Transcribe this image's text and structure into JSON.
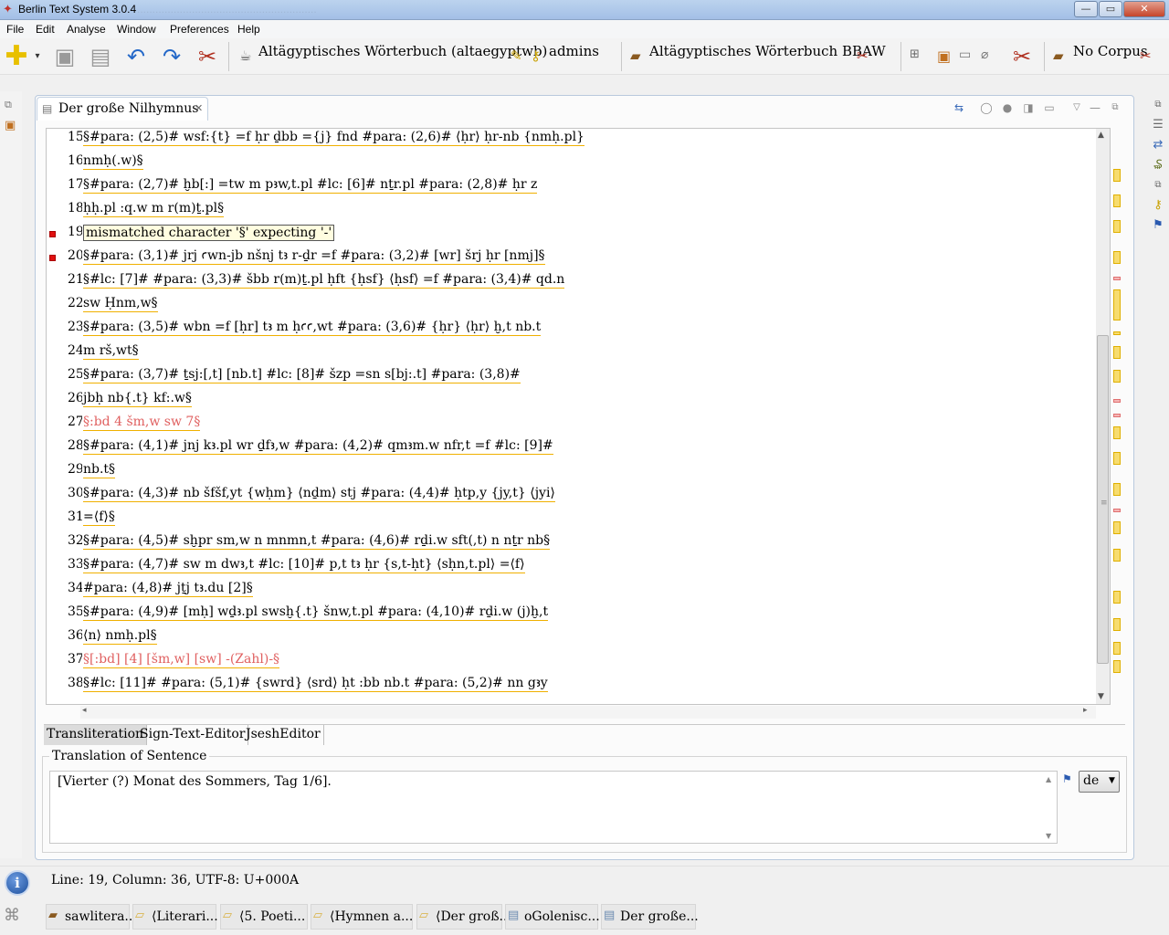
{
  "window": {
    "title": "Berlin Text System 3.0.4",
    "ghost_path": "...........................................................",
    "min": "—",
    "max": "▭",
    "close": "✕"
  },
  "menu": [
    "File",
    "Edit",
    "Analyse",
    "Window",
    "Preferences",
    "Help"
  ],
  "toolbar": {
    "dictionary_label": "Altägyptisches Wörterbuch (altaegyptwb)",
    "user_label": "admins",
    "project_label": "Altägyptisches Wörterbuch BBAW",
    "corpus_label": "No Corpus"
  },
  "editor": {
    "tab_title": "Der große Nilhymnus",
    "tooltip": "mismatched character '§' expecting '-'",
    "lines": [
      {
        "n": "15",
        "text": "§#para: (2,5)# wsf:{t} =f ḥr ḏbb ={j} fnd #para: (2,6)# ⟨ḥr⟩ ḥr-nb {nmḥ.pl}"
      },
      {
        "n": "16",
        "text": "nmḥ(.w)§"
      },
      {
        "n": "17",
        "text": "§#para: (2,7)# ḫb[:] =tw m pꜣw,t.pl #lc: [6]# nṯr.pl #para: (2,8)# ḥr z"
      },
      {
        "n": "18",
        "text": "ḥḥ.pl :q.w m r(m)ṯ.pl§"
      },
      {
        "n": "19",
        "text": ""
      },
      {
        "n": "20",
        "text": "§#para: (3,1)# jrj ꜥwn-jb nšnj tꜣ r-ḏr =f #para: (3,2)# [wr] šrj ḥr [nmj]§"
      },
      {
        "n": "21",
        "text": "§#lc: [7]# #para: (3,3)# šbb r(m)ṯ.pl ḥft {ḥsf} ⟨ḥsf⟩ =f #para: (3,4)# qd.n"
      },
      {
        "n": "22",
        "text": "sw Ḥnm,w§"
      },
      {
        "n": "23",
        "text": "§#para: (3,5)# wbn =f [ḥr] tꜣ m ḥꜥꜥ,wt #para: (3,6)# {ḥr} ⟨ḥr⟩ ḫ,t nb.t"
      },
      {
        "n": "24",
        "text": "m rš,wt§"
      },
      {
        "n": "25",
        "text": "§#para: (3,7)# ṯsj:[,t] [nb.t] #lc: [8]# šzp =sn s[bj:.t] #para: (3,8)#"
      },
      {
        "n": "26",
        "text": "jbḥ nb{.t} kf:.w§"
      },
      {
        "n": "27",
        "text": "§:bd 4 šm,w sw 7§"
      },
      {
        "n": "28",
        "text": "§#para: (4,1)# jnj kꜣ.pl wr ḏfꜣ,w #para: (4,2)# qmꜣm.w nfr,t =f #lc: [9]#"
      },
      {
        "n": "29",
        "text": "nb.t§"
      },
      {
        "n": "30",
        "text": "§#para: (4,3)# nb šfšf,yt {wḥm} ⟨nḏm⟩ stj #para: (4,4)# ḥtp,y {jy,t} ⟨jyi⟩"
      },
      {
        "n": "31",
        "text": "=⟨f⟩§"
      },
      {
        "n": "32",
        "text": "§#para: (4,5)# sḫpr sm,w n mnmn,t #para: (4,6)# rḏi.w sft(,t) n nṯr nb§"
      },
      {
        "n": "33",
        "text": "§#para: (4,7)# sw m dwꜣ,t #lc: [10]# p,t tꜣ ḥr {s,t-ḥt} ⟨sḥn,t.pl⟩ =⟨f⟩"
      },
      {
        "n": "34",
        "text": "#para: (4,8)# jṯj tꜣ.du [2]§"
      },
      {
        "n": "35",
        "text": "§#para: (4,9)# [mḥ] wḏꜣ.pl swsḫ{.t} šnw,t.pl #para: (4,10)# rḏi.w (j)ḫ,t"
      },
      {
        "n": "36",
        "text": "⟨n⟩ nmḥ.pl§"
      },
      {
        "n": "37",
        "text": "§[:bd] [4] [šm,w] [sw] -(Zahl)-§"
      },
      {
        "n": "38",
        "text": "§#lc: [11]# #para: (5,1)# {swrd} ⟨srd⟩ ḥt :bb nb.t #para: (5,2)# nn gꜣy"
      }
    ],
    "bottom_tabs": [
      "Transliteration",
      "Sign-Text-Editor",
      "JseshEditor"
    ]
  },
  "translation": {
    "title": "Translation of Sentence",
    "text": "[Vierter (?) Monat des Sommers, Tag 1/6].",
    "language": "de"
  },
  "status": {
    "text": "Line: 19, Column: 36, UTF-8: U+000A"
  },
  "breadcrumbs": [
    "sawlitera...",
    "⟨Literari...",
    "⟨5. Poeti...",
    "⟨Hymnen a...",
    "⟨Der groß...",
    "oGolenisc...",
    "Der große..."
  ],
  "colors": {
    "error_marker": "#e01010",
    "underline": "#f0b000",
    "comment_text": "#e06060",
    "active_tab": "#dcdcdc"
  }
}
